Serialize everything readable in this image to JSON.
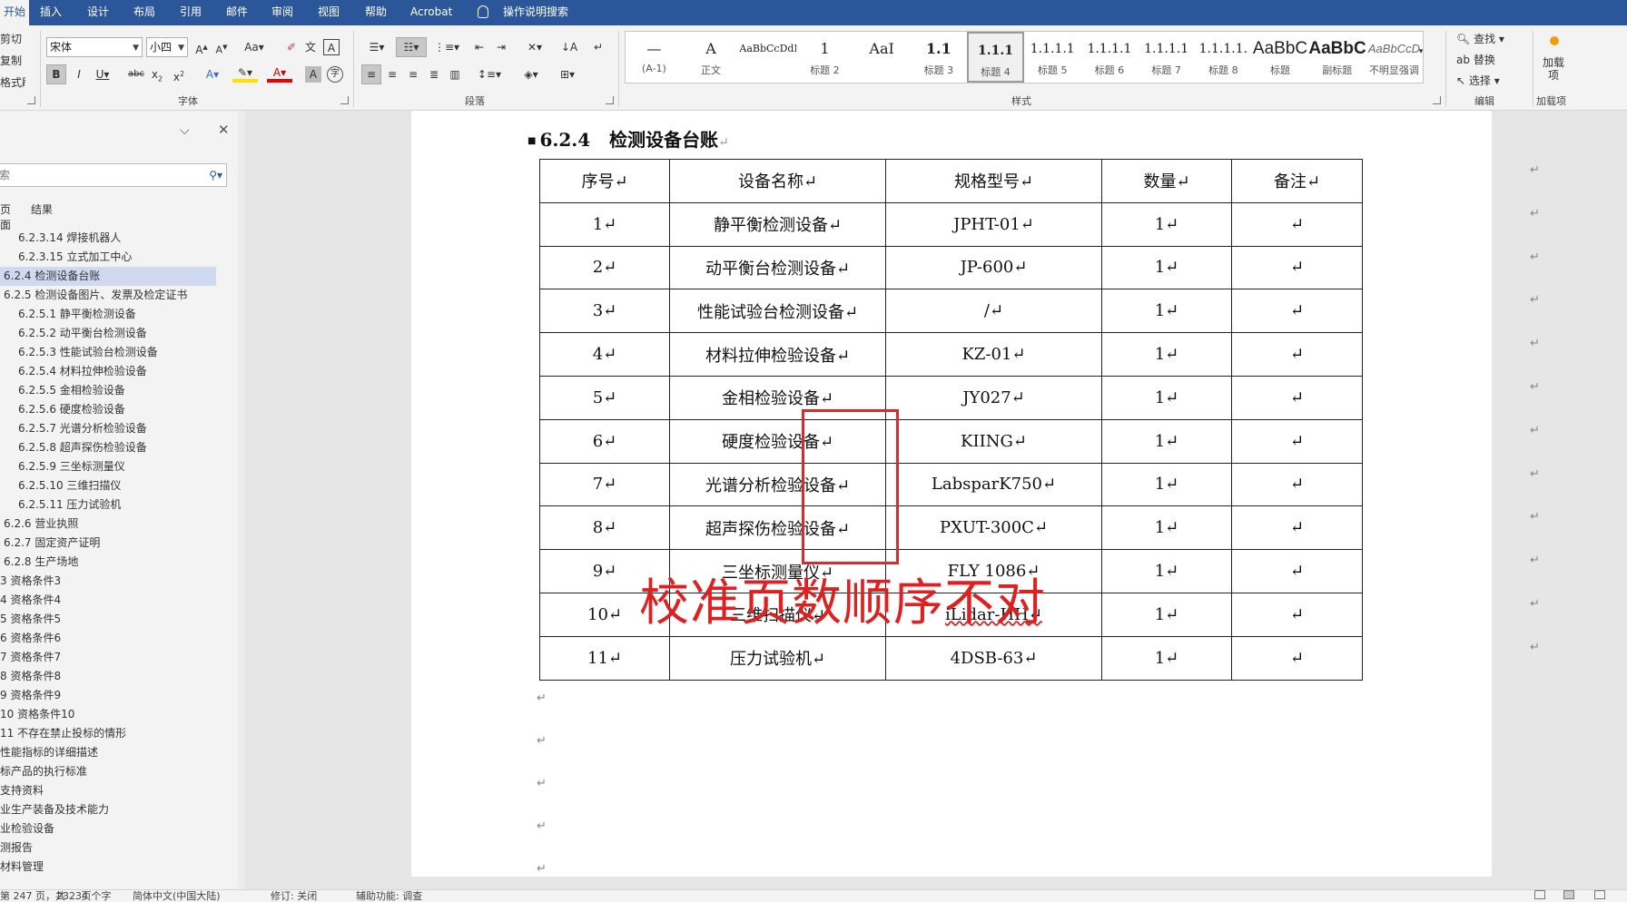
{
  "menubar": {
    "tabs": [
      "开始",
      "插入",
      "设计",
      "布局",
      "引用",
      "邮件",
      "审阅",
      "视图",
      "帮助",
      "Acrobat",
      "操作说明搜索"
    ]
  },
  "clipboard": {
    "cut": "剪切",
    "copy": "复制",
    "format_painter": "格式刷"
  },
  "font": {
    "name": "宋体",
    "size": "小四",
    "group_label": "字体"
  },
  "paragraph": {
    "group_label": "段落"
  },
  "styles": {
    "group_label": "样式",
    "items": [
      {
        "preview": "—",
        "name": "(A-1)"
      },
      {
        "preview": "A",
        "name": "正文"
      },
      {
        "preview": "AaBbCcDdI",
        "name": ""
      },
      {
        "preview": "1",
        "name": "标题 2"
      },
      {
        "preview": "AaI",
        "name": ""
      },
      {
        "preview": "1.1",
        "name": "标题 3"
      },
      {
        "preview": "1.1.1",
        "name": "标题 4"
      },
      {
        "preview": "1.1.1.1",
        "name": "标题 5"
      },
      {
        "preview": "1.1.1.1",
        "name": "标题 6"
      },
      {
        "preview": "1.1.1.1",
        "name": "标题 7"
      },
      {
        "preview": "1.1.1.1.",
        "name": "标题 8"
      },
      {
        "preview": "AaBbC",
        "name": "标题"
      },
      {
        "preview": "AaBbC",
        "name": "副标题"
      },
      {
        "preview": "AaBbCcD",
        "name": "不明显强调"
      }
    ]
  },
  "editing": {
    "find": "查找",
    "replace": "替换",
    "select": "选择",
    "group_label": "编辑"
  },
  "addins": {
    "label": "加载项",
    "button": "加载项",
    "group_label": "加载项"
  },
  "nav": {
    "search_placeholder": "搜索",
    "tab_pages": "页面",
    "tab_results": "结果",
    "items": [
      {
        "text": "6.2.3.14 焊接机器人",
        "indent": 20,
        "active": false
      },
      {
        "text": "6.2.3.15 立式加工中心",
        "indent": 20,
        "active": false
      },
      {
        "text": "6.2.4 检测设备台账",
        "indent": 4,
        "active": true
      },
      {
        "text": "6.2.5 检测设备图片、发票及检定证书",
        "indent": 4,
        "active": false
      },
      {
        "text": "6.2.5.1 静平衡检测设备",
        "indent": 20,
        "active": false
      },
      {
        "text": "6.2.5.2 动平衡台检测设备",
        "indent": 20,
        "active": false
      },
      {
        "text": "6.2.5.3 性能试验台检测设备",
        "indent": 20,
        "active": false
      },
      {
        "text": "6.2.5.4 材料拉伸检验设备",
        "indent": 20,
        "active": false
      },
      {
        "text": "6.2.5.5 金相检验设备",
        "indent": 20,
        "active": false
      },
      {
        "text": "6.2.5.6 硬度检验设备",
        "indent": 20,
        "active": false
      },
      {
        "text": "6.2.5.7 光谱分析检验设备",
        "indent": 20,
        "active": false
      },
      {
        "text": "6.2.5.8 超声探伤检验设备",
        "indent": 20,
        "active": false
      },
      {
        "text": "6.2.5.9 三坐标测量仪",
        "indent": 20,
        "active": false
      },
      {
        "text": "6.2.5.10 三维扫描仪",
        "indent": 20,
        "active": false
      },
      {
        "text": "6.2.5.11 压力试验机",
        "indent": 20,
        "active": false
      },
      {
        "text": "6.2.6 营业执照",
        "indent": 4,
        "active": false
      },
      {
        "text": "6.2.7 固定资产证明",
        "indent": 4,
        "active": false
      },
      {
        "text": "6.2.8 生产场地",
        "indent": 4,
        "active": false
      },
      {
        "text": "3 资格条件3",
        "indent": 0,
        "active": false
      },
      {
        "text": "4 资格条件4",
        "indent": 0,
        "active": false
      },
      {
        "text": "5 资格条件5",
        "indent": 0,
        "active": false
      },
      {
        "text": "6 资格条件6",
        "indent": 0,
        "active": false
      },
      {
        "text": "7 资格条件7",
        "indent": 0,
        "active": false
      },
      {
        "text": "8 资格条件8",
        "indent": 0,
        "active": false
      },
      {
        "text": "9 资格条件9",
        "indent": 0,
        "active": false
      },
      {
        "text": "10 资格条件10",
        "indent": 0,
        "active": false
      },
      {
        "text": "11 不存在禁止投标的情形",
        "indent": 0,
        "active": false
      },
      {
        "text": "性能指标的详细描述",
        "indent": 0,
        "active": false
      },
      {
        "text": "标产品的执行标准",
        "indent": 0,
        "active": false
      },
      {
        "text": "支持资料",
        "indent": 0,
        "active": false
      },
      {
        "text": "业生产装备及技术能力",
        "indent": 0,
        "active": false
      },
      {
        "text": "业检验设备",
        "indent": 0,
        "active": false
      },
      {
        "text": "测报告",
        "indent": 0,
        "active": false
      },
      {
        "text": "材料管理",
        "indent": 0,
        "active": false
      }
    ]
  },
  "doc": {
    "heading_number": "6.2.4",
    "heading_text": "检测设备台账",
    "table": {
      "headers": [
        "序号↵",
        "设备名称↵",
        "规格型号↵",
        "数量↵",
        "备注↵"
      ],
      "rows": [
        [
          "1↵",
          "静平衡检测设备↵",
          "JPHT-01↵",
          "1↵",
          "↵"
        ],
        [
          "2↵",
          "动平衡台检测设备↵",
          "JP-600↵",
          "1↵",
          "↵"
        ],
        [
          "3↵",
          "性能试验台检测设备↵",
          "/↵",
          "1↵",
          "↵"
        ],
        [
          "4↵",
          "材料拉伸检验设备↵",
          "KZ-01↵",
          "1↵",
          "↵"
        ],
        [
          "5↵",
          "金相检验设备↵",
          "JY027↵",
          "1↵",
          "↵"
        ],
        [
          "6↵",
          "硬度检验设备↵",
          "KIING↵",
          "1↵",
          "↵"
        ],
        [
          "7↵",
          "光谱分析检验设备↵",
          "LabsparK750↵",
          "1↵",
          "↵"
        ],
        [
          "8↵",
          "超声探伤检验设备↵",
          "PXUT-300C↵",
          "1↵",
          "↵"
        ],
        [
          "9↵",
          "三坐标测量仪↵",
          "FLY 1086↵",
          "1↵",
          "↵"
        ],
        [
          "10↵",
          "三维扫描仪↵",
          "iLidar-HH↵",
          "1↵",
          "↵"
        ],
        [
          "11↵",
          "压力试验机↵",
          "4DSB-63↵",
          "1↵",
          "↵"
        ]
      ]
    },
    "paragraph_mark": "↵",
    "annotation": "校准页数顺序不对"
  },
  "status": {
    "page": "第 247 页，共 ... 页",
    "words": "23234 个字",
    "language": "简体中文(中国大陆)",
    "track_changes": "修订: 关闭",
    "accessibility": "辅助功能: 调查"
  },
  "colors": {
    "title_bar": "#2b579a",
    "annotation_red": "#e02020"
  }
}
